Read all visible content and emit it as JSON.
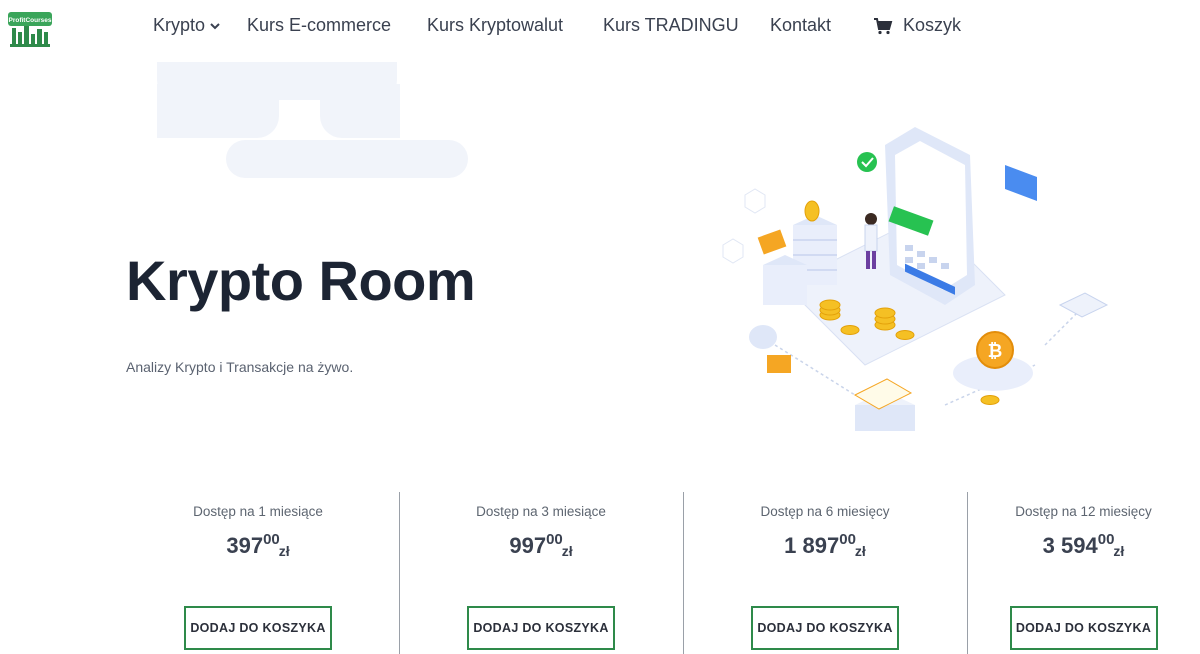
{
  "header": {
    "logo_text": "ProfitCourses",
    "nav": [
      {
        "label": "Krypto"
      },
      {
        "label": "Kurs E-commerce"
      },
      {
        "label": "Kurs Kryptowalut"
      },
      {
        "label": "Kurs TRADINGU"
      },
      {
        "label": "Kontakt"
      },
      {
        "label": "Koszyk"
      }
    ]
  },
  "hero": {
    "title": "Krypto Room",
    "subtitle": "Analizy Krypto i Transakcje na żywo."
  },
  "plans": [
    {
      "title": "Dostęp na 1 miesiące",
      "price_int": "397",
      "price_dec": "00",
      "currency": "zł",
      "button": "DODAJ DO KOSZYKA"
    },
    {
      "title": "Dostęp na 3 miesiące",
      "price_int": "997",
      "price_dec": "00",
      "currency": "zł",
      "button": "DODAJ DO KOSZYKA"
    },
    {
      "title": "Dostęp na 6 miesięcy",
      "price_int": "1 897",
      "price_dec": "00",
      "currency": "zł",
      "button": "DODAJ DO KOSZYKA"
    },
    {
      "title": "Dostęp na 12 miesięcy",
      "price_int": "3 594",
      "price_dec": "00",
      "currency": "zł",
      "button": "DODAJ DO KOSZYKA"
    }
  ],
  "colors": {
    "accent_green": "#2e8a4a",
    "text_dark": "#1c2433",
    "blob": "#f1f4fa"
  },
  "icons": [
    "profitcourses-logo",
    "chevron-down-icon",
    "cart-icon",
    "crypto-illustration"
  ]
}
